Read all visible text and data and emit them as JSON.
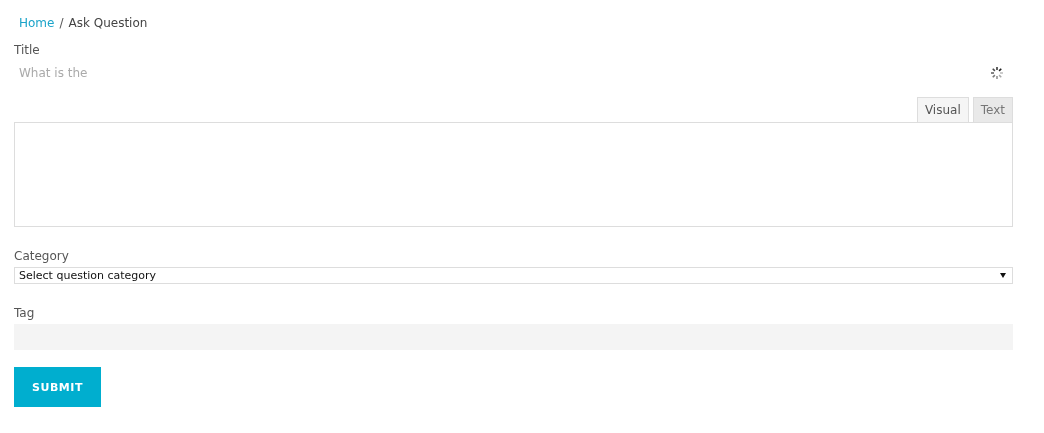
{
  "breadcrumb_separator": "/",
  "breadcrumb": [
    {
      "label": "Home",
      "kind": "link"
    },
    {
      "label": "Ask Question",
      "kind": "current"
    }
  ],
  "title_field": {
    "label": "Title",
    "value": "What is the"
  },
  "editor": {
    "tabs": [
      {
        "label": "Visual",
        "selected": true
      },
      {
        "label": "Text",
        "selected": false
      }
    ]
  },
  "category": {
    "label": "Category",
    "value": "Select question category"
  },
  "tag": {
    "label": "Tag"
  },
  "submit": {
    "label": "SUBMIT"
  }
}
